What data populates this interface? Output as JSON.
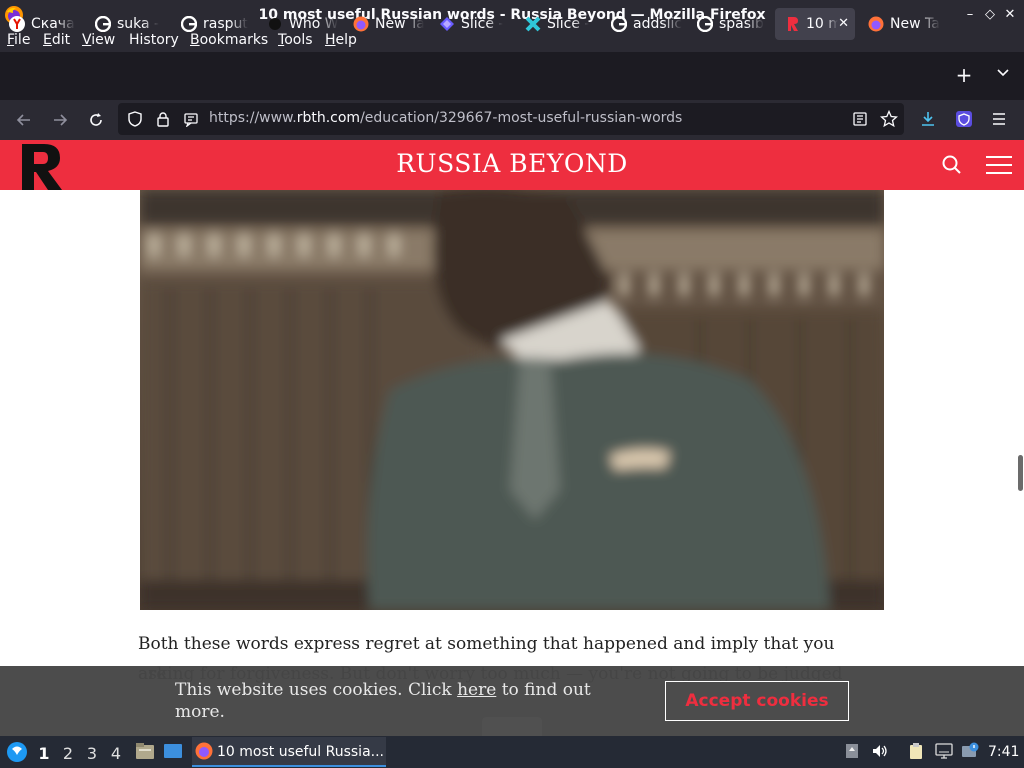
{
  "window": {
    "title": "10 most useful Russian words - Russia Beyond — Mozilla Firefox",
    "controls": [
      "–",
      "◇",
      "✕"
    ]
  },
  "menubar": {
    "items": [
      {
        "label": "File",
        "u": "F",
        "rest": "ile"
      },
      {
        "label": "Edit",
        "u": "E",
        "rest": "dit"
      },
      {
        "label": "View",
        "u": "V",
        "rest": "iew"
      },
      {
        "label": "History",
        "u": "H",
        "rest": "istory",
        "pre": "Hi",
        "uidx": 2
      },
      {
        "label": "Bookmarks",
        "u": "B",
        "rest": "ookmarks"
      },
      {
        "label": "Tools",
        "u": "T",
        "rest": "ools"
      },
      {
        "label": "Help",
        "u": "H",
        "rest": "elp"
      }
    ]
  },
  "tabs": [
    {
      "label": "Скача",
      "icon": "yandex-icon"
    },
    {
      "label": "suka -",
      "icon": "google-icon"
    },
    {
      "label": "rasput",
      "icon": "google-icon"
    },
    {
      "label": "Who W",
      "icon": "page-icon"
    },
    {
      "label": "New Ta",
      "icon": "firefox-icon"
    },
    {
      "label": "Slice -",
      "icon": "slice-icon"
    },
    {
      "label": "Slice -",
      "icon": "slice-icon"
    },
    {
      "label": "addslic",
      "icon": "google-icon"
    },
    {
      "label": "spasib",
      "icon": "google-icon"
    },
    {
      "label": "10 m",
      "icon": "rbth-icon",
      "active": true
    },
    {
      "label": "New Ta",
      "icon": "firefox-icon"
    }
  ],
  "navbar": {
    "url_prefix": "https://www.",
    "url_host": "rbth.com",
    "url_path": "/education/329667-most-useful-russian-words"
  },
  "site": {
    "title": "RUSSIA BEYOND",
    "brand_color": "#ee2e3f"
  },
  "article": {
    "line1": "Both these words express regret at something that happened and imply that you are",
    "line2": "asking for forgiveness. But don't worry too much — you're not going to be judged"
  },
  "cookie": {
    "text_before": "This website uses cookies. Click ",
    "link": "here",
    "text_after": " to find out more.",
    "button": "Accept cookies"
  },
  "taskbar": {
    "workspaces": [
      "1",
      "2",
      "3",
      "4"
    ],
    "current_workspace": "1",
    "task_label": "10 most useful Russia...",
    "clock": "7:41"
  }
}
